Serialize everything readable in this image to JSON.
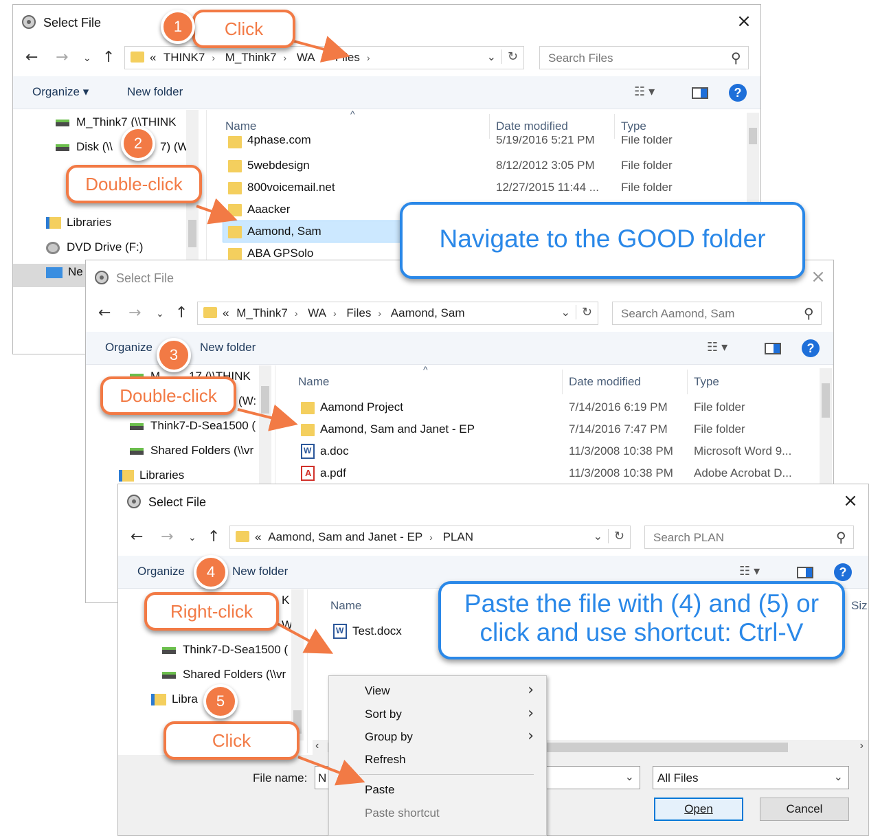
{
  "dialog1": {
    "title": "Select File",
    "close_glyph": "×",
    "breadcrumb": [
      "«",
      "THINK7",
      "M_Think7",
      "WA",
      "Files"
    ],
    "search_placeholder": "Search Files",
    "organize": "Organize ▾",
    "new_folder": "New folder",
    "nav_items": [
      "M_Think7 (\\\\THINK",
      "Disk (\\\\",
      "7) (W:",
      "Libraries",
      "DVD Drive (F:)",
      "Ne"
    ],
    "columns": [
      "Name",
      "Date modified",
      "Type"
    ],
    "rows": [
      {
        "name": "4phase.com",
        "date": "5/19/2016 5:21 PM",
        "type": "File folder"
      },
      {
        "name": "5webdesign",
        "date": "8/12/2012 3:05 PM",
        "type": "File folder"
      },
      {
        "name": "800voicemail.net",
        "date": "12/27/2015 11:44 ...",
        "type": "File folder"
      },
      {
        "name": "Aaacker",
        "date": "",
        "type": ""
      },
      {
        "name": "Aamond, Sam",
        "date": "",
        "type": ""
      },
      {
        "name": "ABA GPSolo",
        "date": "",
        "type": ""
      }
    ]
  },
  "dialog2": {
    "title": "Select File",
    "close_glyph": "×",
    "breadcrumb": [
      "«",
      "M_Think7",
      "WA",
      "Files",
      "Aamond, Sam"
    ],
    "search_placeholder": "Search Aamond, Sam",
    "organize": "Organize",
    "new_folder": "New folder",
    "nav_items": [
      "M",
      "17 (\\\\THINK",
      "(W:",
      "Think7-D-Sea1500 (",
      "Shared Folders (\\\\vr",
      "Libraries"
    ],
    "columns": [
      "Name",
      "Date modified",
      "Type"
    ],
    "rows": [
      {
        "name": "Aamond Project",
        "date": "7/14/2016 6:19 PM",
        "type": "File folder",
        "icon": "folder"
      },
      {
        "name": "Aamond, Sam and Janet - EP",
        "date": "7/14/2016 7:47 PM",
        "type": "File folder",
        "icon": "folder"
      },
      {
        "name": "a.doc",
        "date": "11/3/2008 10:38 PM",
        "type": "Microsoft Word 9...",
        "icon": "word"
      },
      {
        "name": "a.pdf",
        "date": "11/3/2008 10:38 PM",
        "type": "Adobe Acrobat D...",
        "icon": "pdf"
      }
    ]
  },
  "dialog3": {
    "title": "Select File",
    "close_glyph": "×",
    "breadcrumb": [
      "«",
      "Aamond, Sam and Janet - EP",
      "PLAN"
    ],
    "search_placeholder": "Search PLAN",
    "organize": "Organize",
    "new_folder": "New folder",
    "nav_items": [
      "K",
      "W:",
      "Think7-D-Sea1500 (",
      "Shared Folders (\\\\vr",
      "Libra"
    ],
    "columns": [
      "Name",
      "Siz"
    ],
    "rows": [
      {
        "name": "Test.docx",
        "icon": "word"
      }
    ],
    "file_name_label": "File name:",
    "file_name_value": "N",
    "filter_value": "All Files",
    "open_label": "Open",
    "cancel_label": "Cancel"
  },
  "context_menu": {
    "items": [
      {
        "label": "View",
        "submenu": true
      },
      {
        "label": "Sort by",
        "submenu": true
      },
      {
        "label": "Group by",
        "submenu": true
      },
      {
        "label": "Refresh",
        "submenu": false
      },
      {
        "label": "Paste",
        "submenu": false
      },
      {
        "label": "Paste shortcut",
        "submenu": false,
        "disabled": true
      }
    ]
  },
  "callouts": [
    {
      "number": "1",
      "label": "Click"
    },
    {
      "number": "2",
      "label": "Double-click"
    },
    {
      "number": "3",
      "label": "Double-click"
    },
    {
      "number": "4",
      "label": "Right-click"
    },
    {
      "number": "5",
      "label": "Click"
    }
  ],
  "notes": {
    "navigate": "Navigate to the GOOD folder",
    "paste_line1": "Paste the file with (4) and (5) or",
    "paste_line2": "click and use shortcut:  Ctrl-V"
  },
  "colors": {
    "callout": "#f27a45",
    "note": "#2a88e8",
    "selection": "#cce8ff",
    "toolbar": "#f3f6fa"
  }
}
